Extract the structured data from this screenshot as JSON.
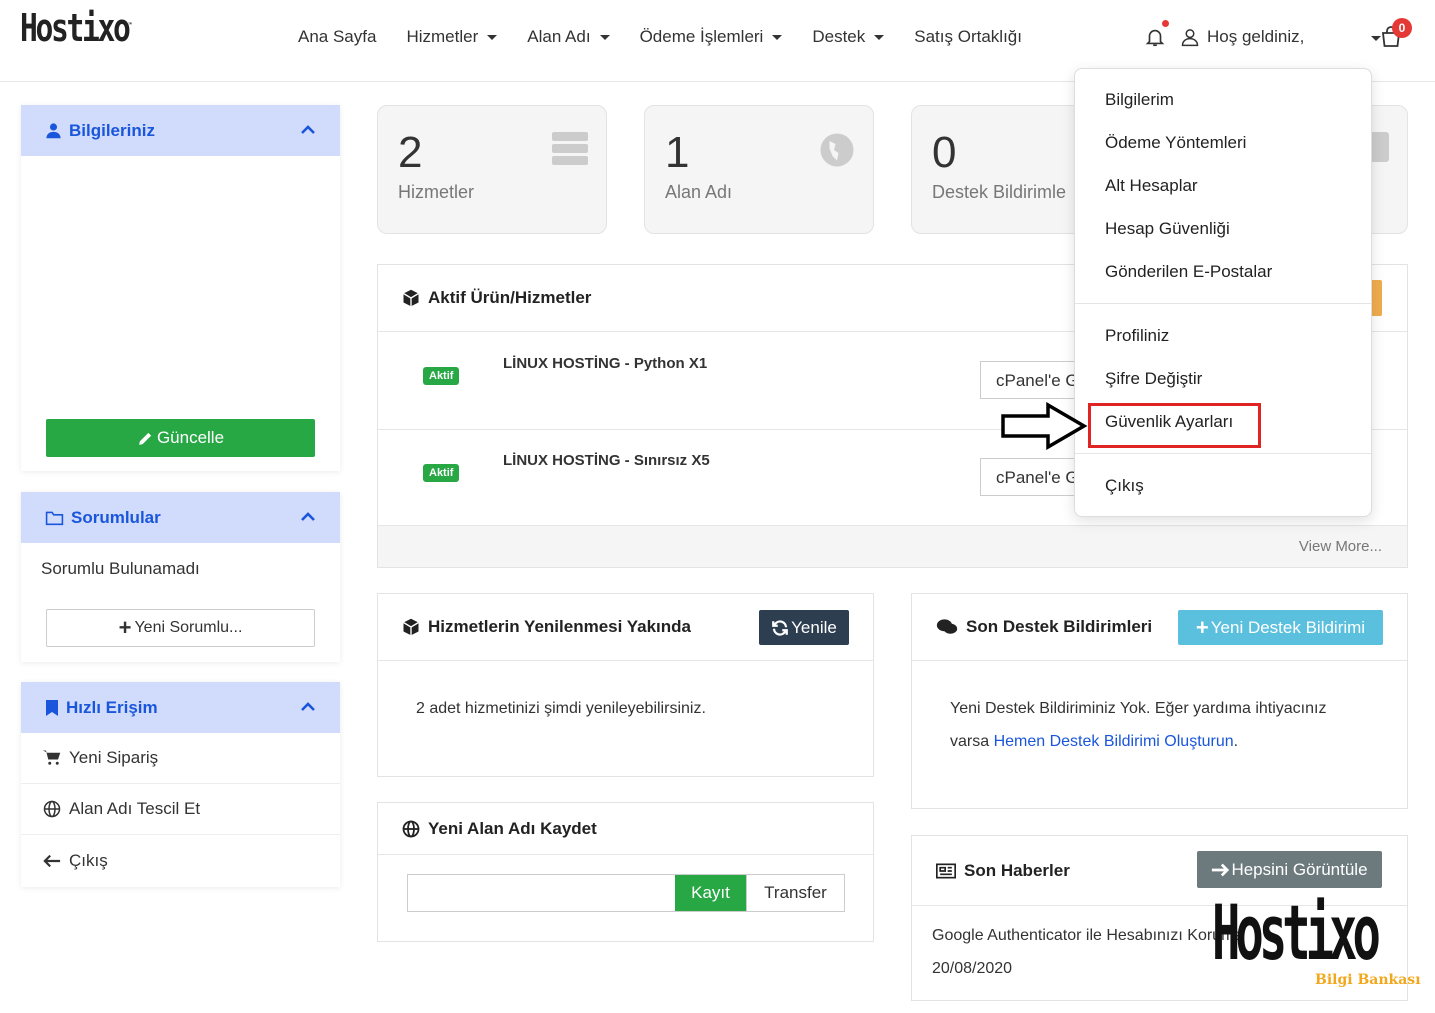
{
  "brand": {
    "logo_text": "Hostixo",
    "tm": "™"
  },
  "nav": {
    "items": [
      {
        "label": "Ana Sayfa",
        "dropdown": false
      },
      {
        "label": "Hizmetler",
        "dropdown": true
      },
      {
        "label": "Alan Adı",
        "dropdown": true
      },
      {
        "label": "Ödeme İşlemleri",
        "dropdown": true
      },
      {
        "label": "Destek",
        "dropdown": true
      },
      {
        "label": "Satış Ortaklığı",
        "dropdown": false
      }
    ],
    "welcome": "Hoş geldiniz,",
    "cart_count": "0"
  },
  "sidebar": {
    "info": {
      "title": "Bilgileriniz",
      "button": "Güncelle"
    },
    "contacts": {
      "title": "Sorumlular",
      "empty": "Sorumlu Bulunamadı",
      "button": "Yeni Sorumlu..."
    },
    "quick": {
      "title": "Hızlı Erişim",
      "items": [
        "Yeni Sipariş",
        "Alan Adı Tescil Et",
        "Çıkış"
      ]
    }
  },
  "stats": [
    {
      "value": "2",
      "label": "Hizmetler"
    },
    {
      "value": "1",
      "label": "Alan Adı"
    },
    {
      "value": "0",
      "label": "Destek Bildirimle"
    }
  ],
  "active_services": {
    "title": "Aktif Ürün/Hizmetler",
    "rows": [
      {
        "status": "Aktif",
        "name": "LİNUX HOSTİNG - Python X1",
        "action": "cPanel'e G"
      },
      {
        "status": "Aktif",
        "name": "LİNUX HOSTİNG - Sınırsız X5",
        "action": "cPanel'e G"
      }
    ],
    "view_more": "View More..."
  },
  "renewals": {
    "title": "Hizmetlerin Yenilenmesi Yakında",
    "button": "Yenile",
    "text": "2 adet hizmetinizi şimdi yenileyebilirsiniz."
  },
  "domain_register": {
    "title": "Yeni Alan Adı Kaydet",
    "input_value": "",
    "register": "Kayıt",
    "transfer": "Transfer"
  },
  "tickets": {
    "title": "Son Destek Bildirimleri",
    "button": "Yeni Destek Bildirimi",
    "text_before": "Yeni Destek Bildiriminiz Yok. Eğer yardıma ihtiyacınız varsa ",
    "link": "Hemen Destek Bildirimi Oluşturun",
    "text_after": "."
  },
  "news": {
    "title": "Son Haberler",
    "button": "Hepsini Görüntüle",
    "item": "Google Authenticator ile Hesabınızı Koruma",
    "date": "20/08/2020"
  },
  "user_menu": {
    "group1": [
      "Bilgilerim",
      "Ödeme Yöntemleri",
      "Alt Hesaplar",
      "Hesap Güvenliği",
      "Gönderilen E-Postalar"
    ],
    "group2": [
      "Profiliniz",
      "Şifre Değiştir",
      "Güvenlik Ayarları"
    ],
    "group3": [
      "Çıkış"
    ]
  },
  "watermark": {
    "title": "Hostixo",
    "subtitle": "Bilgi Bankası"
  },
  "colors": {
    "accent": "#1a56db",
    "panel_header": "#d1dcfd",
    "success": "#28a745",
    "highlight": "#e02424"
  }
}
